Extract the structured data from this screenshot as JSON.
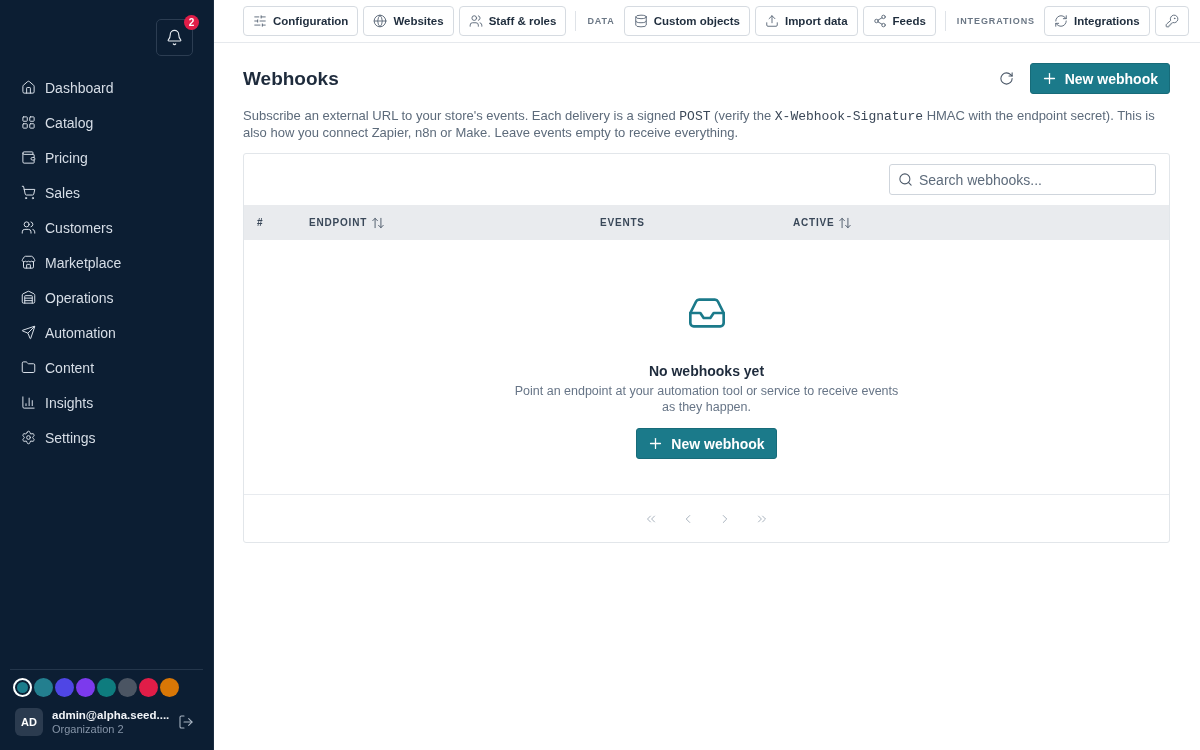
{
  "sidebar": {
    "notifications": {
      "count": "2"
    },
    "items": [
      {
        "label": "Dashboard"
      },
      {
        "label": "Catalog"
      },
      {
        "label": "Pricing"
      },
      {
        "label": "Sales"
      },
      {
        "label": "Customers"
      },
      {
        "label": "Marketplace"
      },
      {
        "label": "Operations"
      },
      {
        "label": "Automation"
      },
      {
        "label": "Content"
      },
      {
        "label": "Insights"
      },
      {
        "label": "Settings"
      }
    ],
    "theme_swatches": [
      {
        "color": "#1b7d8c",
        "selected": true
      },
      {
        "color": "#237f8f",
        "selected": false
      },
      {
        "color": "#4f46e5",
        "selected": false
      },
      {
        "color": "#7c3aed",
        "selected": false
      },
      {
        "color": "#0e7c7e",
        "selected": false
      },
      {
        "color": "#4b5563",
        "selected": false
      },
      {
        "color": "#e11d48",
        "selected": false
      },
      {
        "color": "#d97706",
        "selected": false
      }
    ],
    "user": {
      "initials": "AD",
      "email": "admin@alpha.seed....",
      "organization": "Organization 2"
    }
  },
  "toolbar": [
    {
      "kind": "button",
      "label": "Configuration"
    },
    {
      "kind": "button",
      "label": "Websites"
    },
    {
      "kind": "button",
      "label": "Staff & roles"
    },
    {
      "kind": "section",
      "label": "DATA"
    },
    {
      "kind": "button",
      "label": "Custom objects"
    },
    {
      "kind": "button",
      "label": "Import data"
    },
    {
      "kind": "button",
      "label": "Feeds"
    },
    {
      "kind": "section",
      "label": "INTEGRATIONS"
    },
    {
      "kind": "button",
      "label": "Integrations"
    },
    {
      "kind": "button"
    }
  ],
  "page": {
    "title": "Webhooks",
    "primary_button": "New webhook",
    "description": [
      {
        "kind": "text",
        "text": "Subscribe an external URL to your store's events. Each delivery is a signed "
      },
      {
        "kind": "code",
        "text": "POST"
      },
      {
        "kind": "text",
        "text": " (verify the "
      },
      {
        "kind": "code",
        "text": "X-Webhook-Signature"
      },
      {
        "kind": "text",
        "text": " HMAC with the endpoint secret). This is also how you connect Zapier, n8n or Make. Leave events empty to receive everything."
      }
    ]
  },
  "table": {
    "search": {
      "placeholder": "Search webhooks..."
    },
    "columns": [
      {
        "label": "#",
        "sortable": false
      },
      {
        "label": "ENDPOINT",
        "sortable": true
      },
      {
        "label": "EVENTS",
        "sortable": false
      },
      {
        "label": "ACTIVE",
        "sortable": true
      }
    ],
    "empty_state": {
      "title": "No webhooks yet",
      "text": "Point an endpoint at your automation tool or service to receive events as they happen.",
      "button": "New webhook"
    },
    "pagination": [
      {
        "disabled": true
      },
      {
        "disabled": true
      },
      {
        "disabled": true
      },
      {
        "disabled": true
      }
    ]
  }
}
